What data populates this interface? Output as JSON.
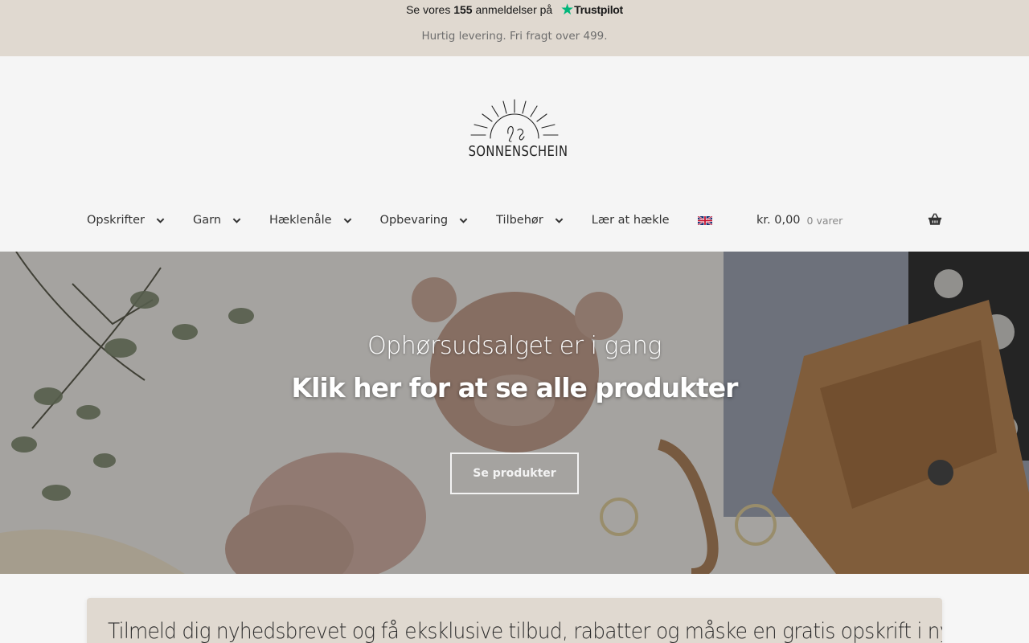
{
  "topbar": {
    "trustpilot": {
      "prefix": "Se vores",
      "count": "155",
      "suffix": "anmeldelser på",
      "brand": "Trustpilot"
    },
    "shipping_text": "Hurtig levering. Fri fragt over 499."
  },
  "header": {
    "logo_text": "SONNENSCHEIN",
    "nav": [
      {
        "label": "Opskrifter",
        "has_dropdown": true
      },
      {
        "label": "Garn",
        "has_dropdown": true
      },
      {
        "label": "Hæklenåle",
        "has_dropdown": true
      },
      {
        "label": "Opbevaring",
        "has_dropdown": true
      },
      {
        "label": "Tilbehør",
        "has_dropdown": true
      },
      {
        "label": "Lær at hækle",
        "has_dropdown": false
      }
    ],
    "language_icon": "uk-flag-icon",
    "cart": {
      "total": "kr. 0,00",
      "count": "0 varer",
      "icon": "basket-icon"
    }
  },
  "hero": {
    "subtitle": "Ophørsudsalget er i gang",
    "title": "Klik her for at se alle produkter",
    "button_label": "Se produkter"
  },
  "newsletter": {
    "text": "Tilmeld dig nyhedsbrevet og få eksklusive tilbud, rabatter og måske en gratis opskrift i ny"
  },
  "colors": {
    "topbar_bg": "#e0d9d0",
    "header_bg": "#f5f5f5",
    "trustpilot_green": "#00b67a",
    "newsletter_bg": "#e0d9d0"
  }
}
